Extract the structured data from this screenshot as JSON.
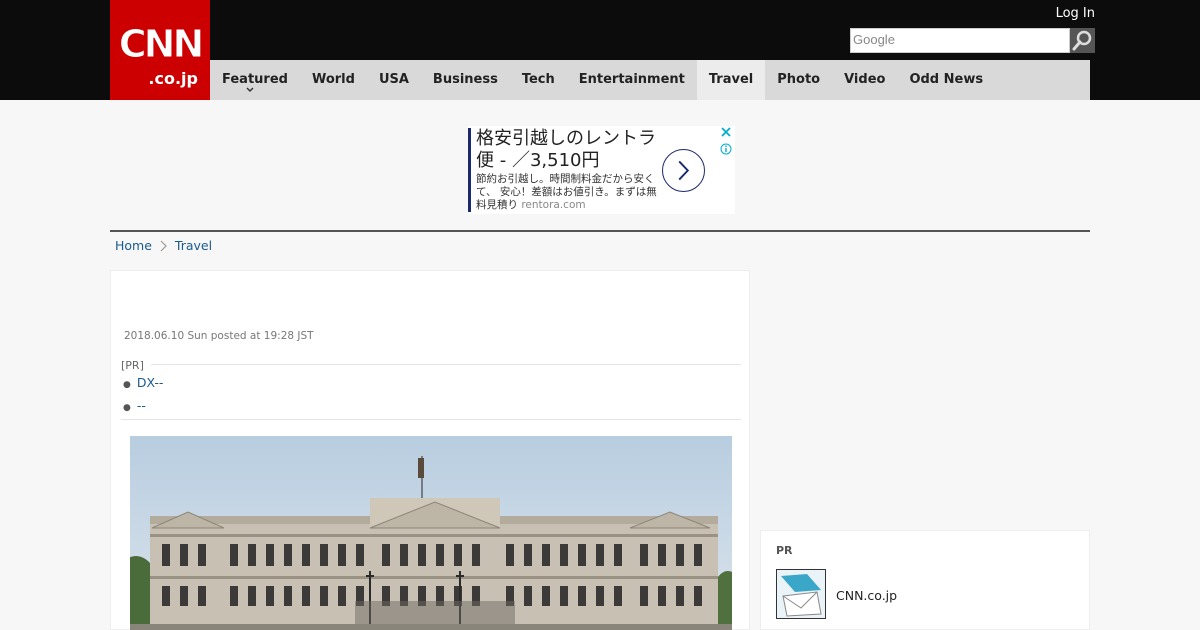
{
  "header": {
    "logo_main": "CNN",
    "logo_sub": ".co.jp",
    "login_label": "Log In",
    "search_placeholder": "Google"
  },
  "nav": {
    "items": [
      {
        "label": "Featured"
      },
      {
        "label": "World"
      },
      {
        "label": "USA"
      },
      {
        "label": "Business"
      },
      {
        "label": "Tech"
      },
      {
        "label": "Entertainment"
      },
      {
        "label": "Travel"
      },
      {
        "label": "Photo"
      },
      {
        "label": "Video"
      },
      {
        "label": "Odd News"
      }
    ],
    "active": "Travel"
  },
  "ad": {
    "title": "格安引越しのレントラ便 - ／3,510円",
    "description": "節約お引越し。時間制料金だから安くて、 安心！差額はお値引き。まずは無料見積り",
    "domain": "rentora.com"
  },
  "breadcrumb": {
    "home": "Home",
    "section": "Travel"
  },
  "article": {
    "date": "2018.06.10 Sun posted at 19:28 JST",
    "pr_label": "[PR]",
    "pr_links": [
      "DX--",
      "--"
    ]
  },
  "sidebar": {
    "pr_label": "PR",
    "item_label": "CNN.co.jp"
  },
  "colors": {
    "brand_red": "#cc0000",
    "header_black": "#0c0c0c",
    "link_blue": "#1a5b8f",
    "ad_accent": "#1a2a6c"
  }
}
